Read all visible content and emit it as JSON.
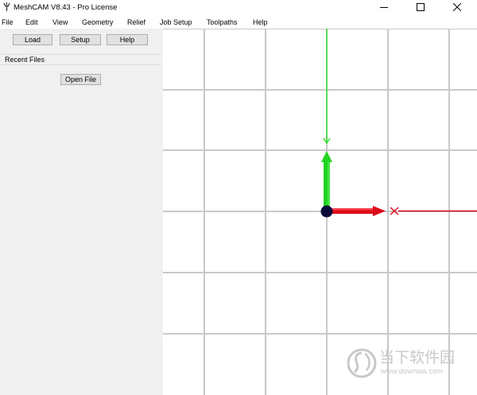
{
  "window": {
    "title": "MeshCAM V8.43 - Pro License",
    "icon": "meshcam-app-icon",
    "controls": [
      "minimize-icon",
      "maximize-icon",
      "close-icon"
    ]
  },
  "menu": [
    "File",
    "Edit",
    "View",
    "Geometry",
    "Relief",
    "Job Setup",
    "Toolpaths",
    "Help"
  ],
  "toolbar": {
    "load_label": "Load",
    "setup_label": "Setup",
    "help_label": "Help"
  },
  "recent": {
    "header": "Recent Files",
    "open_label": "Open File"
  },
  "viewport": {
    "background": "#ffffff",
    "grid_color": "#c8c8c8",
    "x_axis_color": "#e0001b",
    "y_axis_color": "#33e133",
    "origin_color": "#0a0a3a"
  },
  "watermark": {
    "title": "当下软件园",
    "url": "www.downxia.com",
    "icon": "downxia-logo-icon"
  }
}
